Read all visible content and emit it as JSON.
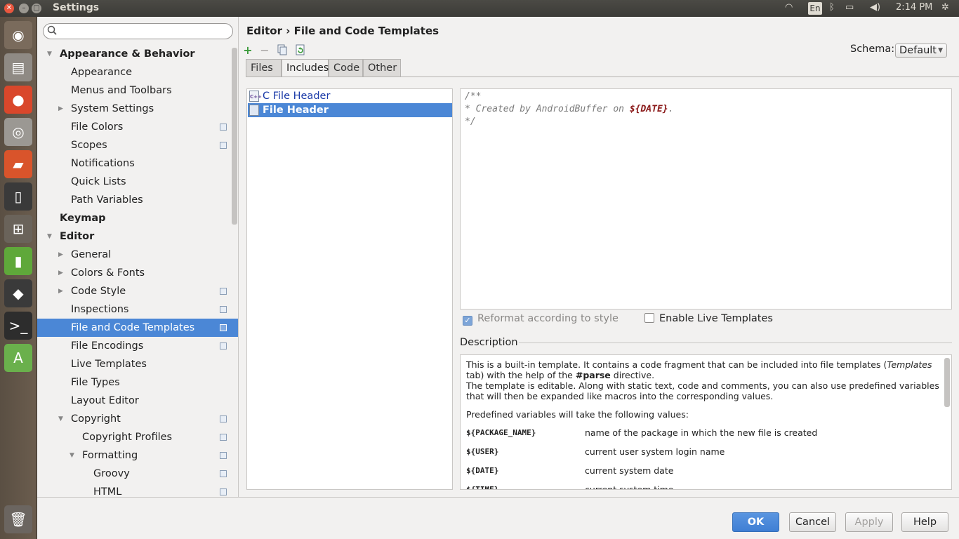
{
  "window": {
    "title": "Settings"
  },
  "indicators": {
    "lang": "En",
    "time": "2:14 PM"
  },
  "launcher": {
    "icons": [
      "dash-icon",
      "files-icon",
      "chrome-icon",
      "camera-icon",
      "folder-icon",
      "phone-icon",
      "workspace-icon",
      "app-icon",
      "inkscape-icon",
      "terminal-icon",
      "android-studio-icon",
      "trash-icon"
    ]
  },
  "search": {
    "value": "",
    "placeholder": ""
  },
  "tree": [
    {
      "label": "Appearance & Behavior",
      "bold": true,
      "indent": 0,
      "arrow": "open"
    },
    {
      "label": "Appearance",
      "indent": 1
    },
    {
      "label": "Menus and Toolbars",
      "indent": 1
    },
    {
      "label": "System Settings",
      "indent": 1,
      "arrow": "closed"
    },
    {
      "label": "File Colors",
      "indent": 1,
      "cfg": true
    },
    {
      "label": "Scopes",
      "indent": 1,
      "cfg": true
    },
    {
      "label": "Notifications",
      "indent": 1
    },
    {
      "label": "Quick Lists",
      "indent": 1
    },
    {
      "label": "Path Variables",
      "indent": 1
    },
    {
      "label": "Keymap",
      "bold": true,
      "indent": 0
    },
    {
      "label": "Editor",
      "bold": true,
      "indent": 0,
      "arrow": "open"
    },
    {
      "label": "General",
      "indent": 1,
      "arrow": "closed"
    },
    {
      "label": "Colors & Fonts",
      "indent": 1,
      "arrow": "closed"
    },
    {
      "label": "Code Style",
      "indent": 1,
      "arrow": "closed",
      "cfg": true
    },
    {
      "label": "Inspections",
      "indent": 1,
      "cfg": true
    },
    {
      "label": "File and Code Templates",
      "indent": 1,
      "cfg": true,
      "selected": true
    },
    {
      "label": "File Encodings",
      "indent": 1,
      "cfg": true
    },
    {
      "label": "Live Templates",
      "indent": 1
    },
    {
      "label": "File Types",
      "indent": 1
    },
    {
      "label": "Layout Editor",
      "indent": 1
    },
    {
      "label": "Copyright",
      "indent": 1,
      "arrow": "open",
      "cfg": true
    },
    {
      "label": "Copyright Profiles",
      "indent": 2,
      "cfg": true
    },
    {
      "label": "Formatting",
      "indent": 2,
      "arrow": "open",
      "cfg": true
    },
    {
      "label": "Groovy",
      "indent": 3,
      "cfg": true
    },
    {
      "label": "HTML",
      "indent": 3,
      "cfg": true
    }
  ],
  "breadcrumb": "Editor › File and Code Templates",
  "schema": {
    "label": "Schema:",
    "value": "Default"
  },
  "tabs": [
    "Files",
    "Includes",
    "Code",
    "Other"
  ],
  "active_tab": "Includes",
  "templates": [
    {
      "name": "C File Header",
      "icon": "C++",
      "selected": false
    },
    {
      "name": "File Header",
      "icon": "",
      "selected": true
    }
  ],
  "editor": {
    "line1": "/**",
    "line2_text": "* Created by AndroidBuffer on ",
    "line2_var": "${DATE}",
    "line2_end": ".",
    "line3": "*/"
  },
  "options": {
    "reformat": {
      "label": "Reformat according to style",
      "checked": true,
      "disabled": true
    },
    "live_templates": {
      "label": "Enable Live Templates",
      "checked": false
    }
  },
  "description": {
    "heading": "Description",
    "p1a": "This is a built-in template. It contains a code fragment that can be included into file templates (",
    "p1_em": "Templates",
    "p1b": " tab) with the help of the ",
    "p1_strong": "#parse",
    "p1c": " directive.",
    "p2": "The template is editable. Along with static text, code and comments, you can also use predefined variables that will then be expanded like macros into the corresponding values.",
    "p3": "Predefined variables will take the following values:",
    "vars": [
      {
        "key": "${PACKAGE_NAME}",
        "val": "name of the package in which the new file is created"
      },
      {
        "key": "${USER}",
        "val": "current user system login name"
      },
      {
        "key": "${DATE}",
        "val": "current system date"
      },
      {
        "key": "${TIME}",
        "val": "current system time"
      }
    ]
  },
  "buttons": {
    "ok": "OK",
    "cancel": "Cancel",
    "apply": "Apply",
    "help": "Help"
  }
}
